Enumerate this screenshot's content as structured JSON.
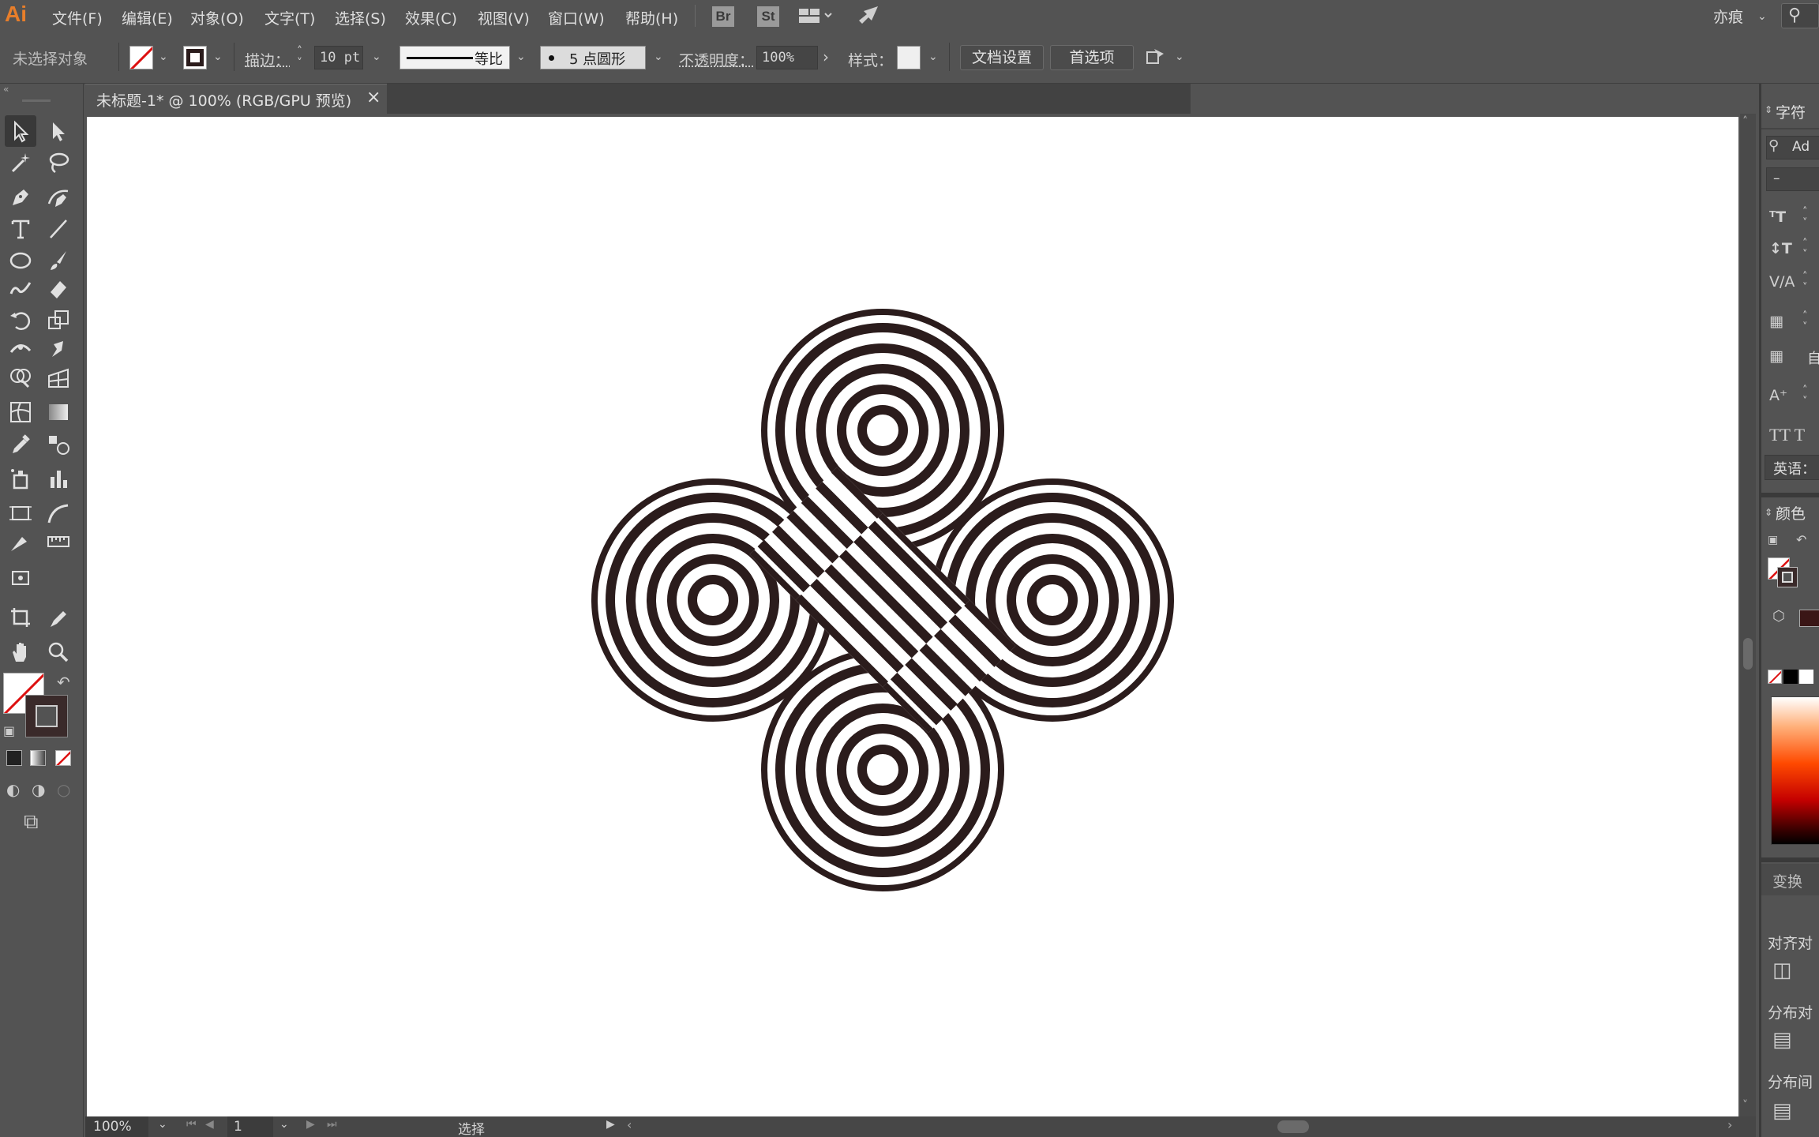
{
  "app": {
    "logo": "Ai",
    "workspace": "亦痕"
  },
  "menu": [
    "文件(F)",
    "编辑(E)",
    "对象(O)",
    "文字(T)",
    "选择(S)",
    "效果(C)",
    "视图(V)",
    "窗口(W)",
    "帮助(H)"
  ],
  "bridge": {
    "br": "Br",
    "st": "St"
  },
  "control": {
    "selection": "未选择对象",
    "stroke_label": "描边：",
    "stroke_value": "10 pt",
    "profile_label": "等比",
    "brush": "5 点圆形",
    "opacity_label": "不透明度：",
    "opacity_value": "100%",
    "style_label": "样式：",
    "doc_setup": "文档设置",
    "prefs": "首选项"
  },
  "document": {
    "tab_title": "未标题-1* @ 100% (RGB/GPU 预览)",
    "close": "×"
  },
  "status": {
    "zoom": "100%",
    "page": "1",
    "tool": "选择"
  },
  "panels": {
    "character": {
      "title": "字符",
      "font": "Ad",
      "style": "–",
      "auto": "自",
      "lang": "英语：",
      "tt": "TT T"
    },
    "color": {
      "title": "颜色"
    },
    "transform": {
      "title": "变换"
    },
    "align": {
      "align_objects": "对齐对",
      "distribute_objects": "分布对",
      "distribute_spacing": "分布间"
    }
  },
  "colors": {
    "accent": "#e87e2a",
    "artwork": "#2b1c1c",
    "fill_stroke": "#3a2a2a"
  }
}
